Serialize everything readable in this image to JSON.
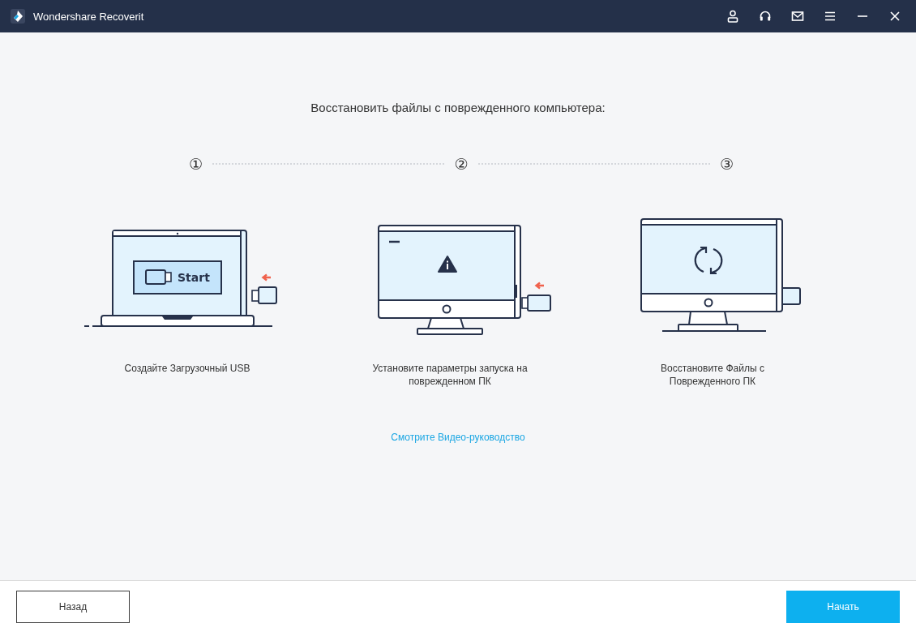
{
  "window": {
    "title": "Wondershare Recoverit"
  },
  "heading": "Восстановить файлы с поврежденного компьютера:",
  "steps": [
    {
      "number": "①",
      "kind": "laptop",
      "screen_label": "Start",
      "caption_lines": [
        "Создайте Загрузочный USB"
      ]
    },
    {
      "number": "②",
      "kind": "monitor-warning",
      "caption_lines": [
        "Установите параметры запуска на",
        "поврежденном ПК"
      ]
    },
    {
      "number": "③",
      "kind": "monitor-sync",
      "caption_lines": [
        "Восстановите Файлы с",
        "Поврежденного ПК"
      ]
    }
  ],
  "video_link": "Смотрите Видео-руководство",
  "buttons": [
    {
      "label": "Назад",
      "kind": "secondary"
    },
    {
      "label": "Начать",
      "kind": "primary"
    }
  ]
}
